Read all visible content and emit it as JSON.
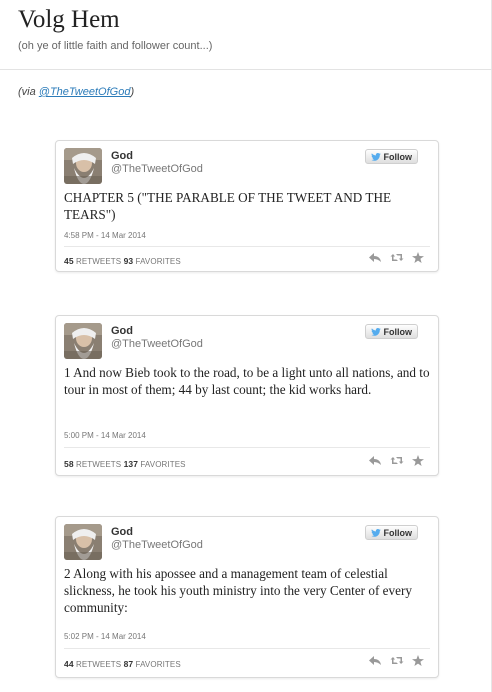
{
  "blog": {
    "title": "Volg Hem",
    "description": "(oh ye of little faith and follower count...)"
  },
  "via": {
    "prefix": "(via ",
    "link": "@TheTweetOfGod",
    "suffix": ")"
  },
  "tweets": [
    {
      "name": "God",
      "handle": "@TheTweetOfGod",
      "follow_label": "Follow",
      "text": "CHAPTER 5 (\"THE PARABLE OF THE TWEET AND THE TEARS\")",
      "timestamp": "4:58 PM - 14 Mar 2014",
      "retweets": "45",
      "retweets_label": "RETWEETS",
      "favorites": "93",
      "favorites_label": "FAVORITES"
    },
    {
      "name": "God",
      "handle": "@TheTweetOfGod",
      "follow_label": "Follow",
      "text": "1 And now Bieb took to the road, to be a light unto all nations, and to tour in most of them; 44 by last count; the kid works hard.",
      "timestamp": "5:00 PM - 14 Mar 2014",
      "retweets": "58",
      "retweets_label": "RETWEETS",
      "favorites": "137",
      "favorites_label": "FAVORITES"
    },
    {
      "name": "God",
      "handle": "@TheTweetOfGod",
      "follow_label": "Follow",
      "text": "2 Along with his apossee and a management team of celestial slickness, he took his youth ministry into the very Center of every community:",
      "timestamp": "5:02 PM - 14 Mar 2014",
      "retweets": "44",
      "retweets_label": "RETWEETS",
      "favorites": "87",
      "favorites_label": "FAVORITES"
    }
  ],
  "icons": {
    "avatar": "bearded-god-avatar",
    "follow": "twitter-bird-icon",
    "reply": "reply-icon",
    "retweet": "retweet-icon",
    "favorite": "star-icon"
  },
  "colors": {
    "link": "#2b7bb9",
    "twitter_blue": "#55acee"
  }
}
